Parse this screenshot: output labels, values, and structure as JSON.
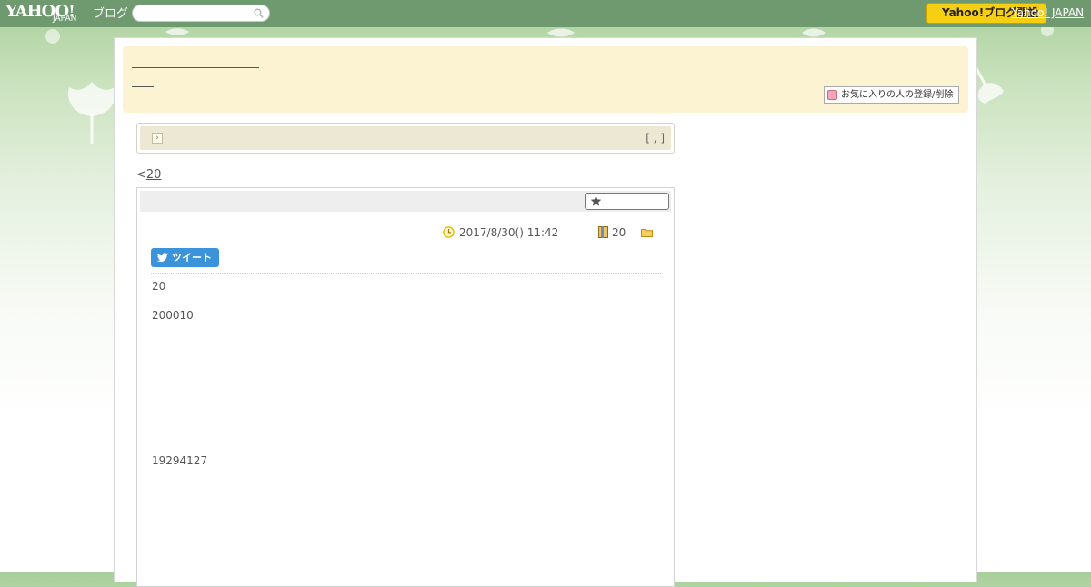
{
  "topbar": {
    "logo_main": "YAHOO!",
    "logo_sub": "JAPAN",
    "logo_blog": "ブログ",
    "search_placeholder": "",
    "login_label": "Yahoo!ブログ開設",
    "yahoo_japan_link": "Yahoo! JAPAN"
  },
  "header": {
    "favorite_button": "お気に入りの人の登録/削除"
  },
  "category": {
    "right_text": "[ , ]"
  },
  "nav": {
    "prev_symbol": "<",
    "prev_link": "20"
  },
  "article": {
    "date": "2017/8/30()  11:42",
    "comment_count": "20",
    "tweet_label": "ツイート",
    "paragraphs": [
      "20",
      "200010",
      "19294127"
    ]
  },
  "colors": {
    "topbar": "#6f9a70",
    "header_band": "#fbf3d2",
    "category_band": "#ece8d3",
    "login_button": "#f7cf12",
    "tweet_button": "#3b94d9"
  }
}
